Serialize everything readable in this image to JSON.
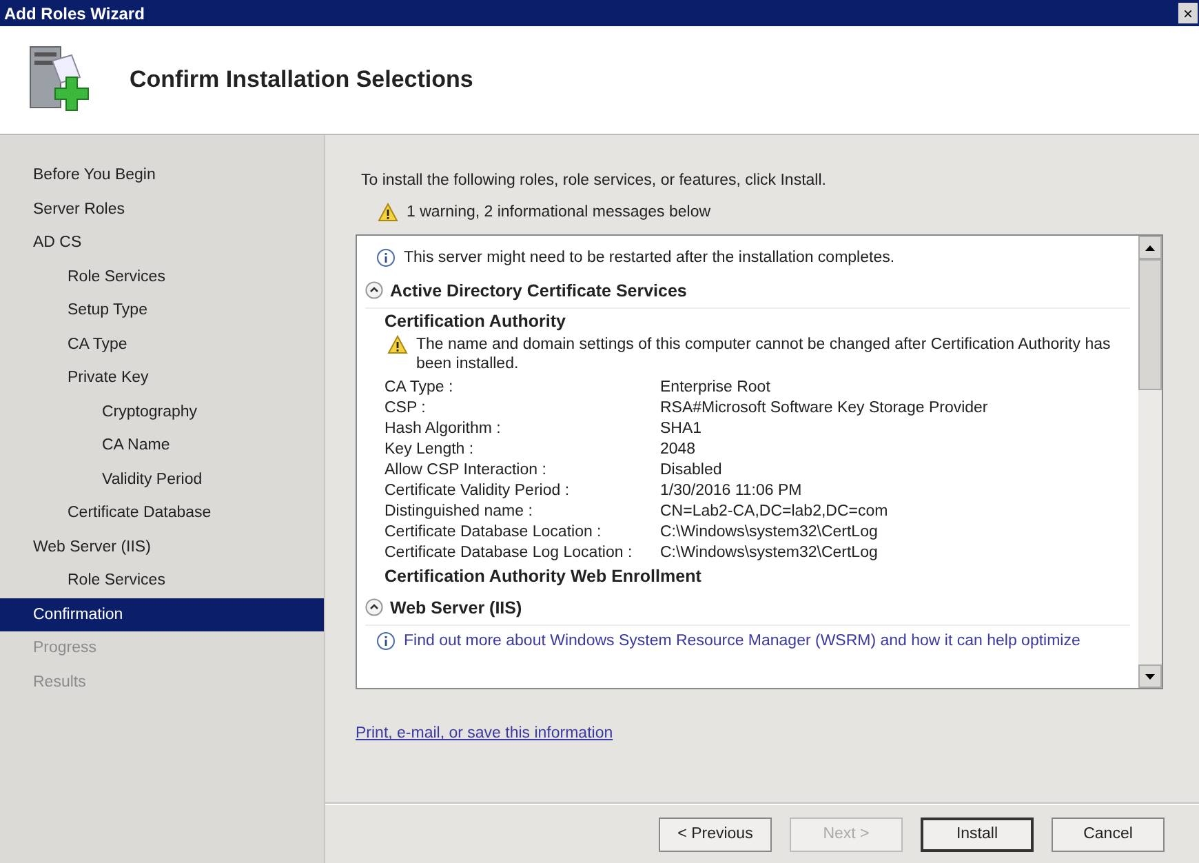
{
  "window": {
    "title": "Add Roles Wizard",
    "close": "×"
  },
  "header": {
    "title": "Confirm Installation Selections"
  },
  "nav": [
    {
      "label": "Before You Begin",
      "selected": false,
      "disabled": false
    },
    {
      "label": "Server Roles",
      "selected": false,
      "disabled": false
    },
    {
      "label": "AD CS",
      "selected": false,
      "disabled": false,
      "children": [
        {
          "label": "Role Services",
          "selected": false,
          "disabled": false
        },
        {
          "label": "Setup Type",
          "selected": false,
          "disabled": false
        },
        {
          "label": "CA Type",
          "selected": false,
          "disabled": false
        },
        {
          "label": "Private Key",
          "selected": false,
          "disabled": false,
          "children": [
            {
              "label": "Cryptography",
              "selected": false,
              "disabled": false
            },
            {
              "label": "CA Name",
              "selected": false,
              "disabled": false
            },
            {
              "label": "Validity Period",
              "selected": false,
              "disabled": false
            }
          ]
        },
        {
          "label": "Certificate Database",
          "selected": false,
          "disabled": false
        }
      ]
    },
    {
      "label": "Web Server (IIS)",
      "selected": false,
      "disabled": false,
      "children": [
        {
          "label": "Role Services",
          "selected": false,
          "disabled": false
        }
      ]
    },
    {
      "label": "Confirmation",
      "selected": true,
      "disabled": false
    },
    {
      "label": "Progress",
      "selected": false,
      "disabled": true
    },
    {
      "label": "Results",
      "selected": false,
      "disabled": true
    }
  ],
  "intro": "To install the following roles, role services, or features, click Install.",
  "summary": "1 warning, 2 informational messages below",
  "content": [
    {
      "kind": "info",
      "text": "This server might need to be restarted after the installation completes."
    },
    {
      "kind": "section",
      "title": "Active Directory Certificate Services",
      "expanded": true
    },
    {
      "kind": "subheading",
      "text": "Certification Authority"
    },
    {
      "kind": "warning",
      "text": "The name and domain settings of this computer cannot be changed after Certification Authority has been installed."
    },
    {
      "kind": "row",
      "label": "CA Type :",
      "value": "Enterprise Root"
    },
    {
      "kind": "row",
      "label": "CSP :",
      "value": "RSA#Microsoft Software Key Storage Provider"
    },
    {
      "kind": "row",
      "label": "Hash Algorithm :",
      "value": "SHA1"
    },
    {
      "kind": "row",
      "label": "Key Length :",
      "value": "2048"
    },
    {
      "kind": "row",
      "label": "Allow CSP Interaction :",
      "value": "Disabled"
    },
    {
      "kind": "row",
      "label": "Certificate Validity Period :",
      "value": "1/30/2016 11:06 PM"
    },
    {
      "kind": "row",
      "label": "Distinguished name :",
      "value": "CN=Lab2-CA,DC=lab2,DC=com"
    },
    {
      "kind": "row",
      "label": "Certificate Database Location :",
      "value": "C:\\Windows\\system32\\CertLog"
    },
    {
      "kind": "row",
      "label": "Certificate Database Log Location :",
      "value": "C:\\Windows\\system32\\CertLog"
    },
    {
      "kind": "subheading",
      "text": "Certification Authority Web Enrollment"
    },
    {
      "kind": "section",
      "title": "Web Server (IIS)",
      "expanded": true
    },
    {
      "kind": "info-link",
      "text": "Find out more about Windows System Resource Manager (WSRM) and how it can help optimize"
    }
  ],
  "link": "Print, e-mail, or save this information",
  "buttons": [
    {
      "label": "< Previous",
      "disabled": false,
      "default": false
    },
    {
      "label": "Next >",
      "disabled": true,
      "default": false
    },
    {
      "label": "Install",
      "disabled": false,
      "default": true
    },
    {
      "label": "Cancel",
      "disabled": false,
      "default": false
    }
  ]
}
